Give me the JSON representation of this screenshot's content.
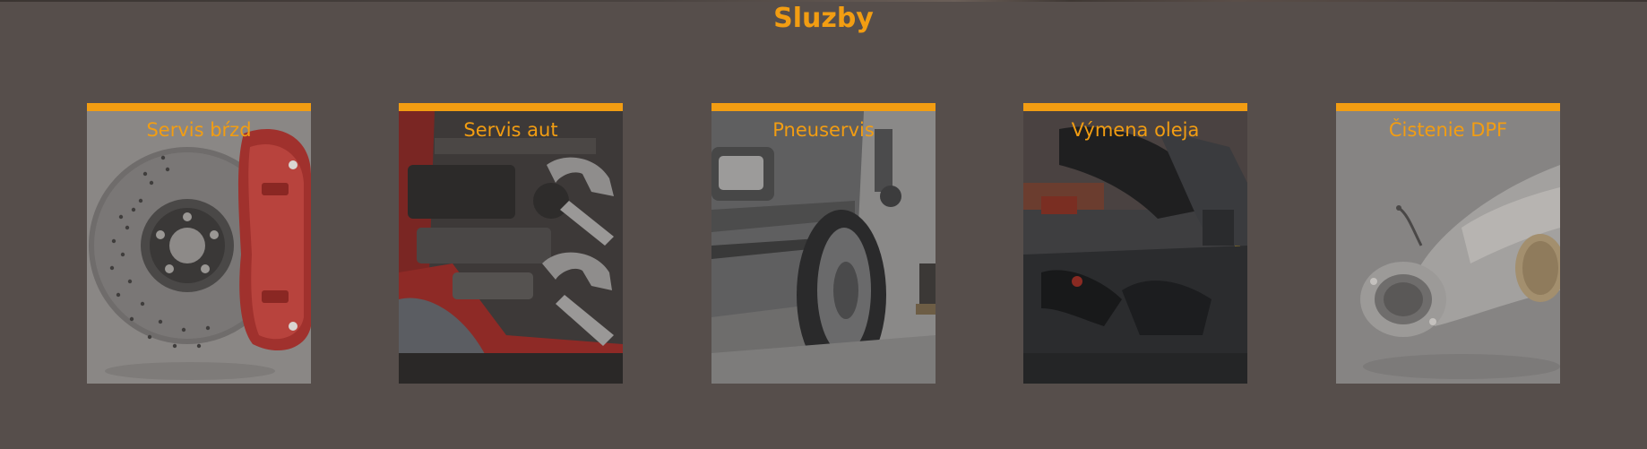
{
  "page": {
    "section_title": "Sluzby"
  },
  "services": [
    {
      "title": "Servis bŕzd",
      "image": "brake-disc-caliper-image"
    },
    {
      "title": "Servis aut",
      "image": "engine-bay-wrenches-image"
    },
    {
      "title": "Pneuservis",
      "image": "car-wheel-tire-image"
    },
    {
      "title": "Výmena oleja",
      "image": "oil-change-engine-image"
    },
    {
      "title": "Čistenie DPF",
      "image": "dpf-exhaust-pipe-image"
    }
  ],
  "colors": {
    "background": "#564e4b",
    "accent": "#f29d12",
    "card_overlay": "#7b7876"
  }
}
